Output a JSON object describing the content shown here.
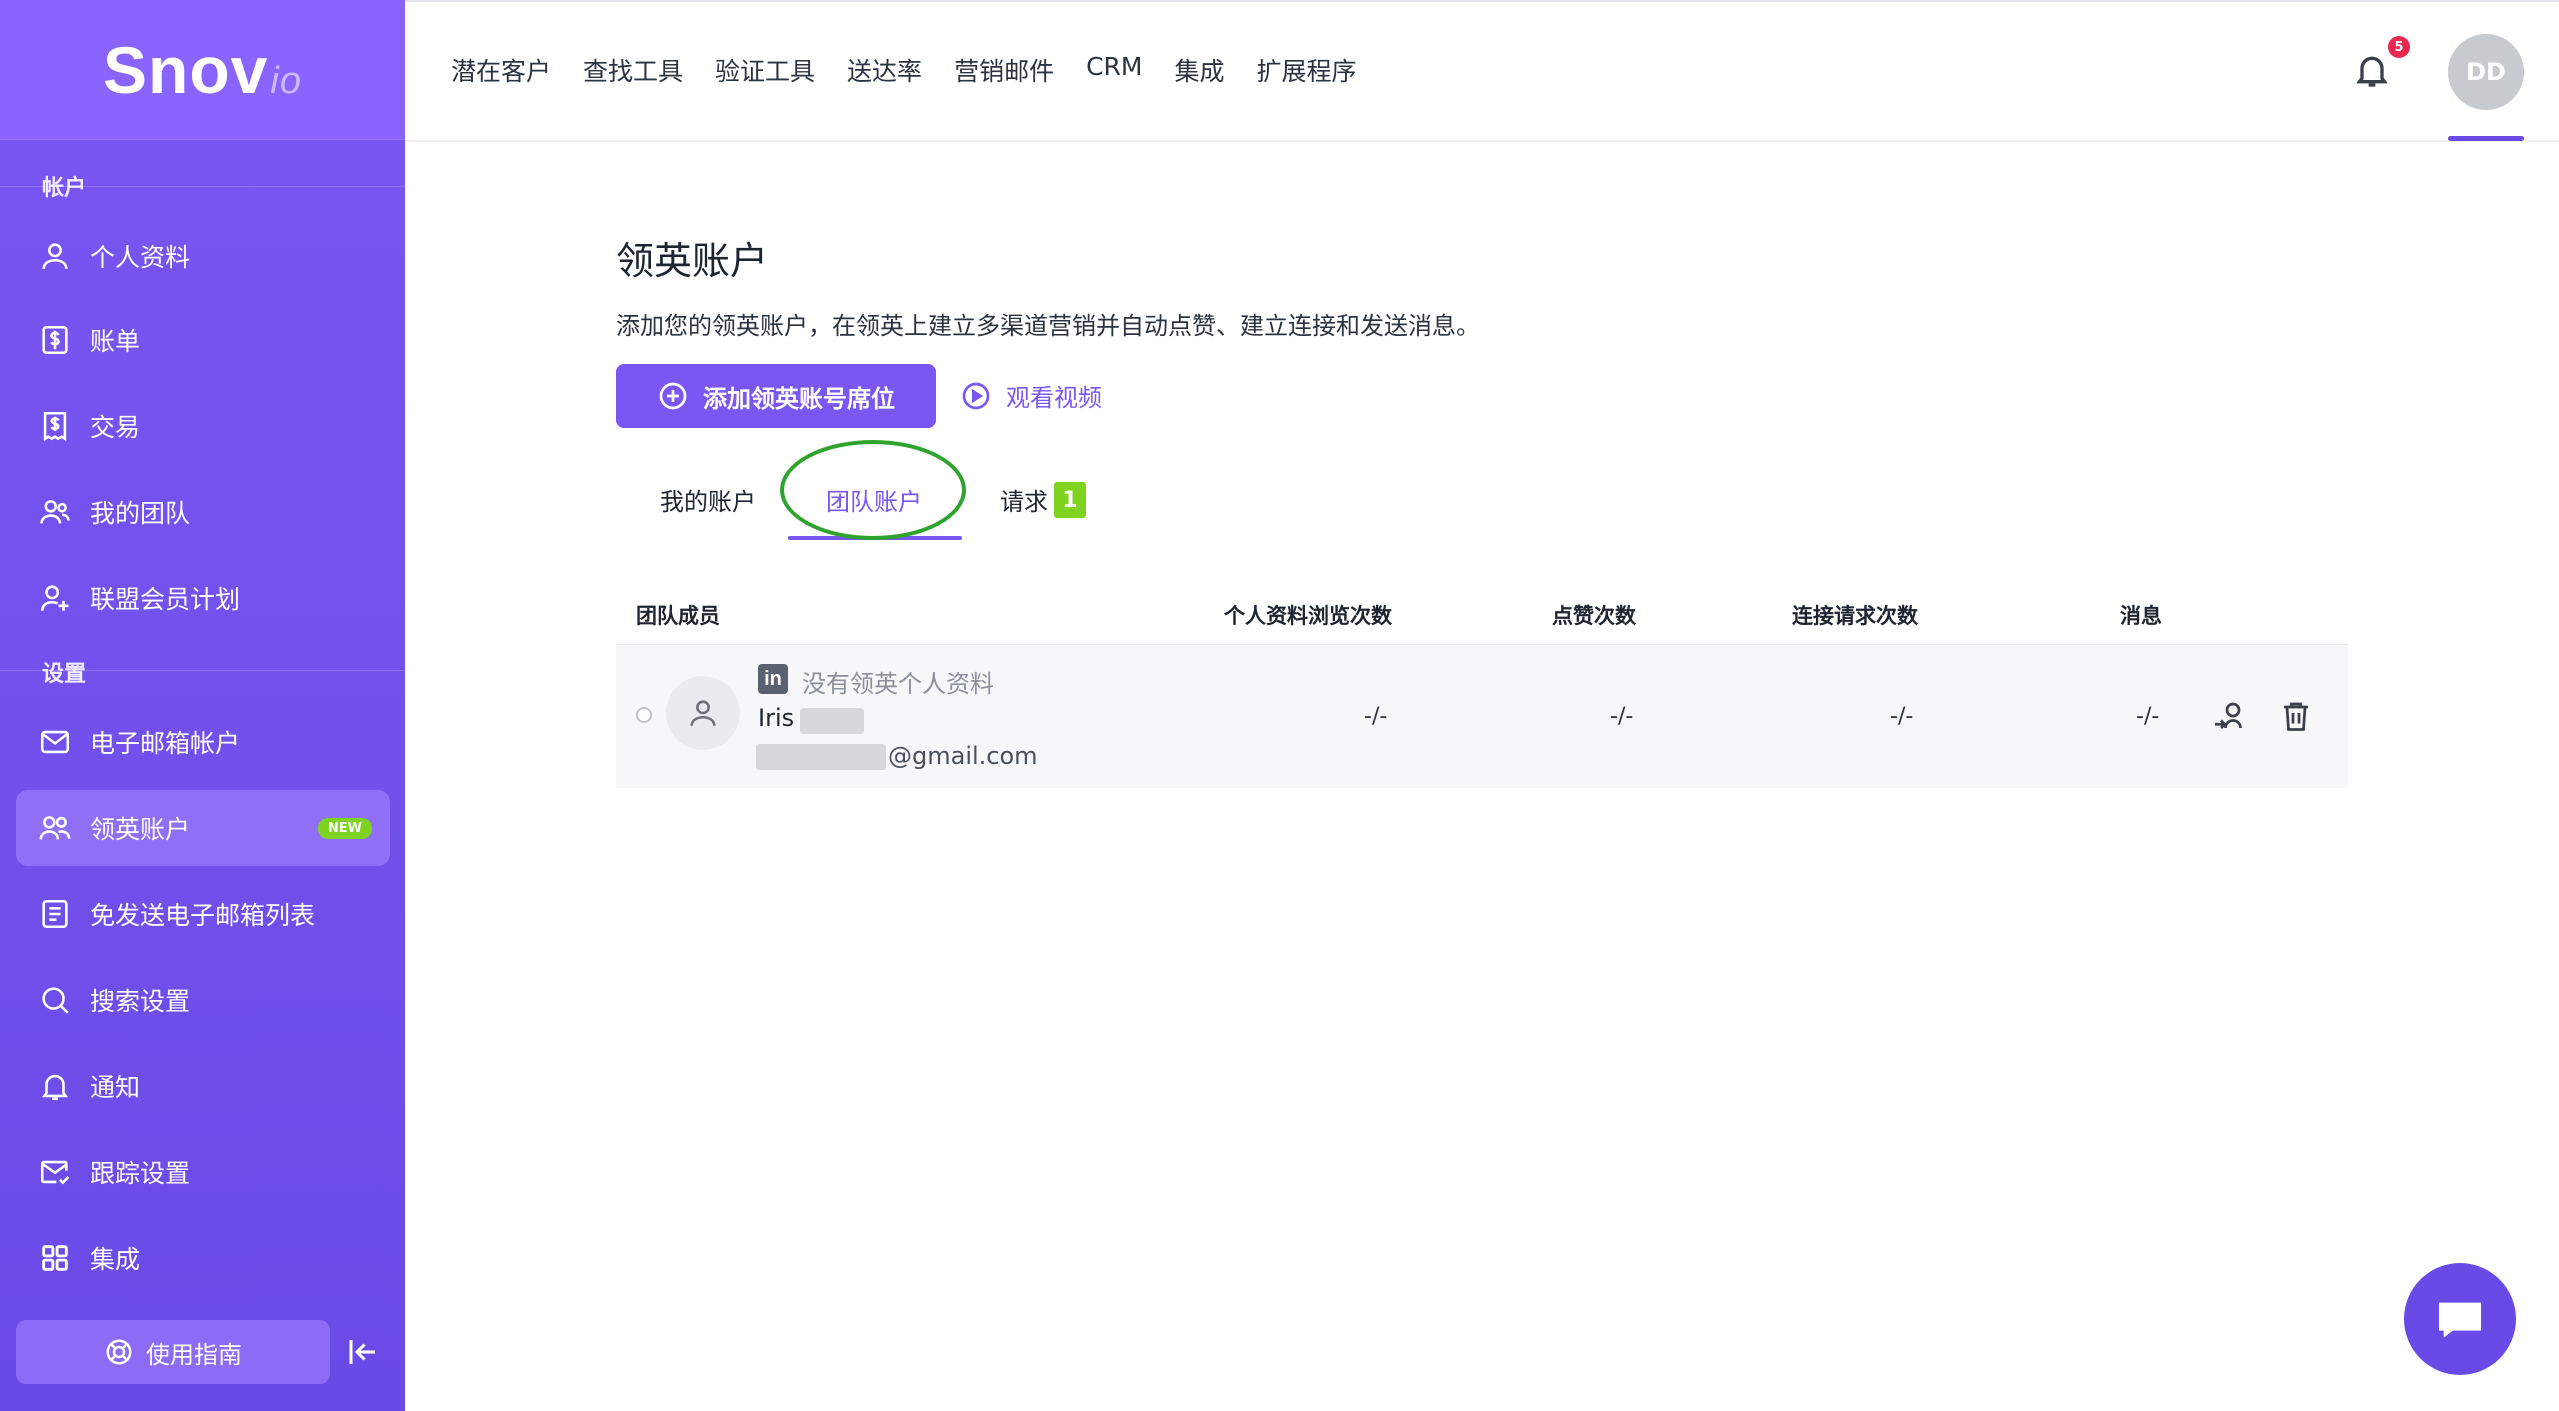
{
  "brand": {
    "logo_main": "Snov",
    "logo_suffix": "io"
  },
  "sidebar": {
    "section_account": "帐户",
    "section_settings": "设置",
    "items": [
      {
        "label": "个人资料",
        "icon": "user-icon"
      },
      {
        "label": "账单",
        "icon": "dollar-doc-icon"
      },
      {
        "label": "交易",
        "icon": "receipt-icon"
      },
      {
        "label": "我的团队",
        "icon": "team-icon"
      },
      {
        "label": "联盟会员计划",
        "icon": "user-plus-icon"
      },
      {
        "label": "电子邮箱帐户",
        "icon": "mail-icon"
      },
      {
        "label": "领英账户",
        "icon": "people-icon",
        "badge": "NEW"
      },
      {
        "label": "免发送电子邮箱列表",
        "icon": "list-doc-icon"
      },
      {
        "label": "搜索设置",
        "icon": "search-icon"
      },
      {
        "label": "通知",
        "icon": "bell-icon"
      },
      {
        "label": "跟踪设置",
        "icon": "mail-track-icon"
      },
      {
        "label": "集成",
        "icon": "grid-icon"
      }
    ],
    "guide_label": "使用指南"
  },
  "topnav": {
    "items": [
      "潜在客户",
      "查找工具",
      "验证工具",
      "送达率",
      "营销邮件",
      "CRM",
      "集成",
      "扩展程序"
    ],
    "notification_count": "5",
    "avatar_initials": "DD"
  },
  "main": {
    "title": "领英账户",
    "description": "添加您的领英账户，在领英上建立多渠道营销并自动点赞、建立连接和发送消息。",
    "add_button": "添加领英账号席位",
    "video_link": "观看视频",
    "tabs": [
      "我的账户",
      "团队账户",
      "请求"
    ],
    "active_tab": "团队账户",
    "request_count": "1",
    "table": {
      "headers": [
        "团队成员",
        "个人资料浏览次数",
        "点赞次数",
        "连接请求次数",
        "消息"
      ],
      "rows": [
        {
          "linkedin_status": "没有领英个人资料",
          "name": "Iris",
          "email_suffix": "@gmail.com",
          "profile_views": "-/-",
          "likes": "-/-",
          "connection_requests": "-/-",
          "messages": "-/-"
        }
      ]
    }
  },
  "colors": {
    "accent": "#7a57f3",
    "sidebar": "#6a4ae6",
    "badge_green": "#7ed321",
    "badge_red": "#e8284f"
  }
}
